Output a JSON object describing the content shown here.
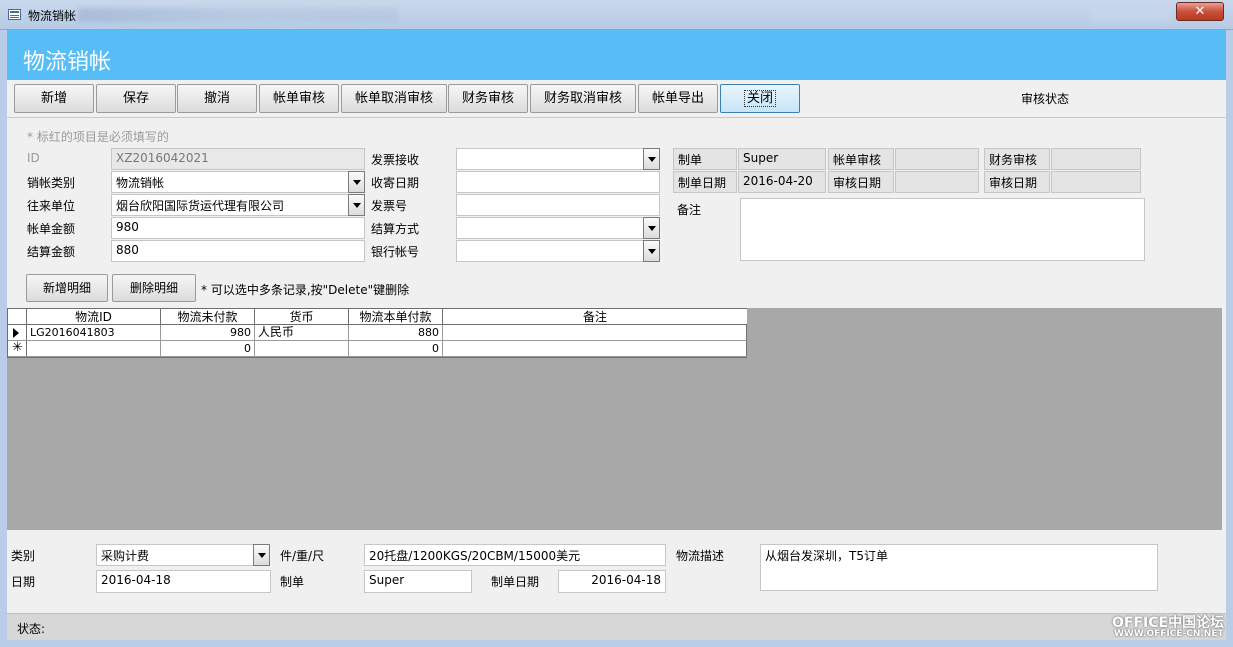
{
  "window": {
    "title": "物流销帐",
    "close_label": "✕"
  },
  "header": {
    "title": "物流销帐"
  },
  "toolbar": {
    "buttons": [
      "新增",
      "保存",
      "撤消",
      "帐单审核",
      "帐单取消审核",
      "财务审核",
      "财务取消审核",
      "帐单导出",
      "关闭"
    ],
    "audit_status_label": "审核状态"
  },
  "form": {
    "hint": "* 标红的项目是必须填写的",
    "id_label": "ID",
    "id_value": "XZ2016042021",
    "type_label": "销帐类别",
    "type_value": "物流销帐",
    "partner_label": "往来单位",
    "partner_value": "烟台欣阳国际货运代理有限公司",
    "bill_amount_label": "帐单金额",
    "bill_amount_value": "980",
    "settle_amount_label": "结算金额",
    "settle_amount_value": "880",
    "invoice_recv_label": "发票接收",
    "invoice_recv_value": "",
    "mail_date_label": "收寄日期",
    "mail_date_value": "",
    "invoice_no_label": "发票号",
    "invoice_no_value": "",
    "settle_method_label": "结算方式",
    "settle_method_value": "",
    "bank_account_label": "银行帐号",
    "bank_account_value": "",
    "maker_label": "制单",
    "maker_value": "Super",
    "bill_audit_label": "帐单审核",
    "bill_audit_value": "",
    "finance_audit_label": "财务审核",
    "finance_audit_value": "",
    "make_date_label": "制单日期",
    "make_date_value": "2016-04-20",
    "audit_date_label": "审核日期",
    "audit_date_value": "",
    "audit_date2_label": "审核日期",
    "audit_date2_value": "",
    "remark_label": "备注",
    "remark_value": ""
  },
  "detail": {
    "add_label": "新增明细",
    "delete_label": "删除明细",
    "tip": "* 可以选中多条记录,按\"Delete\"键删除"
  },
  "grid": {
    "columns": [
      "物流ID",
      "物流未付款",
      "货币",
      "物流本单付款",
      "备注"
    ],
    "rows": [
      {
        "id": "LG2016041803",
        "unpaid": "980",
        "currency": "人民币",
        "paid": "880",
        "remark": ""
      },
      {
        "id": "",
        "unpaid": "0",
        "currency": "",
        "paid": "0",
        "remark": ""
      }
    ]
  },
  "bottom": {
    "category_label": "类别",
    "category_value": "采购计费",
    "pieces_label": "件/重/尺",
    "pieces_value": "20托盘/1200KGS/20CBM/15000美元",
    "desc_label": "物流描述",
    "desc_value": "从烟台发深圳，T5订单",
    "date_label": "日期",
    "date_value": "2016-04-18",
    "maker_label": "制单",
    "maker_value": "Super",
    "make_date_label": "制单日期",
    "make_date_value": "2016-04-18"
  },
  "statusbar": {
    "label": "状态:"
  },
  "watermark": {
    "line1": "OFFICE中国论坛",
    "line2": "WWW.OFFICE-CN.NET"
  }
}
